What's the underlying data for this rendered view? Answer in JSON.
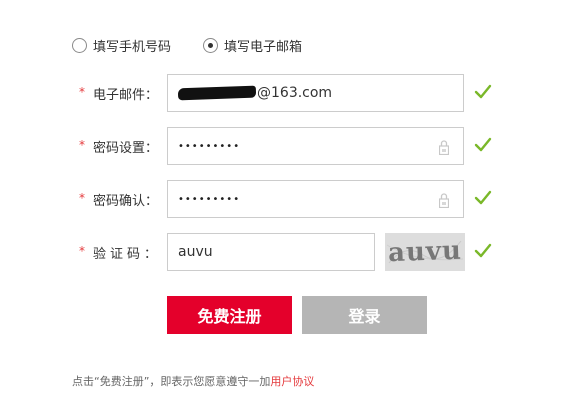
{
  "radio_options": [
    {
      "label": "填写手机号码",
      "checked": false
    },
    {
      "label": "填写电子邮箱",
      "checked": true
    }
  ],
  "required_mark": "*",
  "email": {
    "label": "电子邮件：",
    "value_suffix": "@163.com"
  },
  "password": {
    "label": "密码设置：",
    "value": "•••••••••"
  },
  "confirm_password": {
    "label": "密码确认：",
    "value": "•••••••••"
  },
  "captcha": {
    "label": "验证码：",
    "value": "auvu",
    "image_text": "auvu"
  },
  "buttons": {
    "register": "免费注册",
    "login": "登录"
  },
  "footer": {
    "text": "点击“免费注册”，即表示您愿意遵守一加",
    "link": "用户协议"
  },
  "colors": {
    "accent": "#e4002b",
    "check": "#7ab829",
    "login_button": "#b5b5b5"
  }
}
